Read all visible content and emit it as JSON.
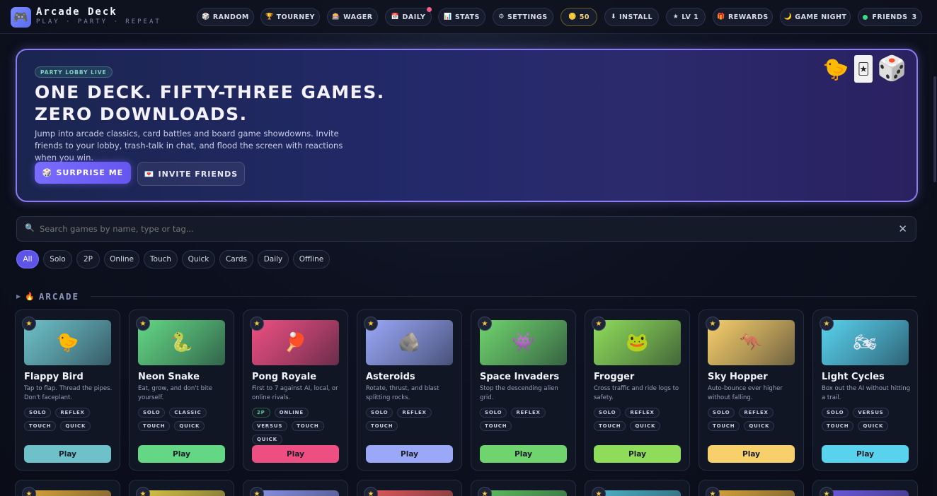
{
  "brand": {
    "logo_icon": "🎮",
    "title": "Arcade Deck",
    "tagline": "PLAY · PARTY · REPEAT"
  },
  "nav": [
    {
      "icon": "🎲",
      "label": "RANDOM"
    },
    {
      "icon": "🏆",
      "label": "TOURNEY"
    },
    {
      "icon": "🎰",
      "label": "WAGER"
    },
    {
      "icon": "📅",
      "label": "DAILY"
    },
    {
      "icon": "📊",
      "label": "STATS"
    },
    {
      "icon": "⚙",
      "label": "SETTINGS"
    },
    {
      "icon": "🪙",
      "label": "50"
    },
    {
      "icon": "⬇",
      "label": "INSTALL"
    },
    {
      "icon": "★",
      "label": "LV 1"
    },
    {
      "icon": "🎁",
      "label": "REWARDS"
    },
    {
      "icon": "🌙",
      "label": "GAME NIGHT"
    },
    {
      "icon": "",
      "label": "FRIENDS",
      "count": "3"
    }
  ],
  "hero": {
    "tag": "PARTY LOBBY LIVE",
    "headline_1": "ONE DECK. FIFTY-THREE GAMES.",
    "headline_2": "ZERO DOWNLOADS.",
    "description": "Jump into arcade classics, card battles and board game showdowns. Invite friends to your lobby, trash-talk in chat, and flood the screen with reactions when you win.",
    "primary_icon": "🎲",
    "primary_label": "SURPRISE ME",
    "secondary_icon": "💌",
    "secondary_label": "INVITE FRIENDS",
    "decor": [
      "🐤",
      "🃏",
      "🎲"
    ]
  },
  "search": {
    "placeholder": "Search games by name, type or tag...",
    "value": ""
  },
  "filters": [
    "All",
    "Solo",
    "2P",
    "Online",
    "Touch",
    "Quick",
    "Cards",
    "Daily",
    "Offline"
  ],
  "active_filter": "All",
  "section": {
    "icon": "🔥",
    "title": "ARCADE"
  },
  "play_label": "Play",
  "games": [
    {
      "name": "Flappy Bird",
      "desc": "Tap to flap. Thread the pipes. Don't faceplant.",
      "emoji": "🐤",
      "tags": [
        "SOLO",
        "REFLEX",
        "TOUCH",
        "QUICK"
      ],
      "accent": "#6ec1c9"
    },
    {
      "name": "Neon Snake",
      "desc": "Eat, grow, and don't bite yourself.",
      "emoji": "🐍",
      "tags": [
        "SOLO",
        "CLASSIC",
        "TOUCH",
        "QUICK"
      ],
      "accent": "#63d784"
    },
    {
      "name": "Pong Royale",
      "desc": "First to 7 against AI, local, or online rivals.",
      "emoji": "🏓",
      "tags": [
        "2P",
        "ONLINE",
        "VERSUS",
        "TOUCH",
        "QUICK"
      ],
      "accent": "#ee4f83"
    },
    {
      "name": "Asteroids",
      "desc": "Rotate, thrust, and blast splitting rocks.",
      "emoji": "🪨",
      "tags": [
        "SOLO",
        "REFLEX",
        "TOUCH"
      ],
      "accent": "#9aa8f7"
    },
    {
      "name": "Space Invaders",
      "desc": "Stop the descending alien grid.",
      "emoji": "👾",
      "tags": [
        "SOLO",
        "REFLEX",
        "TOUCH"
      ],
      "accent": "#6fd36e"
    },
    {
      "name": "Frogger",
      "desc": "Cross traffic and ride logs to safety.",
      "emoji": "🐸",
      "tags": [
        "SOLO",
        "REFLEX",
        "TOUCH",
        "QUICK"
      ],
      "accent": "#8fdc5a"
    },
    {
      "name": "Sky Hopper",
      "desc": "Auto-bounce ever higher without falling.",
      "emoji": "🦘",
      "tags": [
        "SOLO",
        "REFLEX",
        "TOUCH",
        "QUICK"
      ],
      "accent": "#f7cf6b"
    },
    {
      "name": "Light Cycles",
      "desc": "Box out the AI without hitting a trail.",
      "emoji": "🏍",
      "tags": [
        "SOLO",
        "VERSUS",
        "TOUCH",
        "QUICK"
      ],
      "accent": "#59d2ee"
    }
  ],
  "next_row_accents": [
    "#d9a53a",
    "#d9c646",
    "#8a93e8",
    "#e05a5a",
    "#5fbf5f",
    "#4fb3c9",
    "#d9a53a",
    "#6f5ae0"
  ]
}
